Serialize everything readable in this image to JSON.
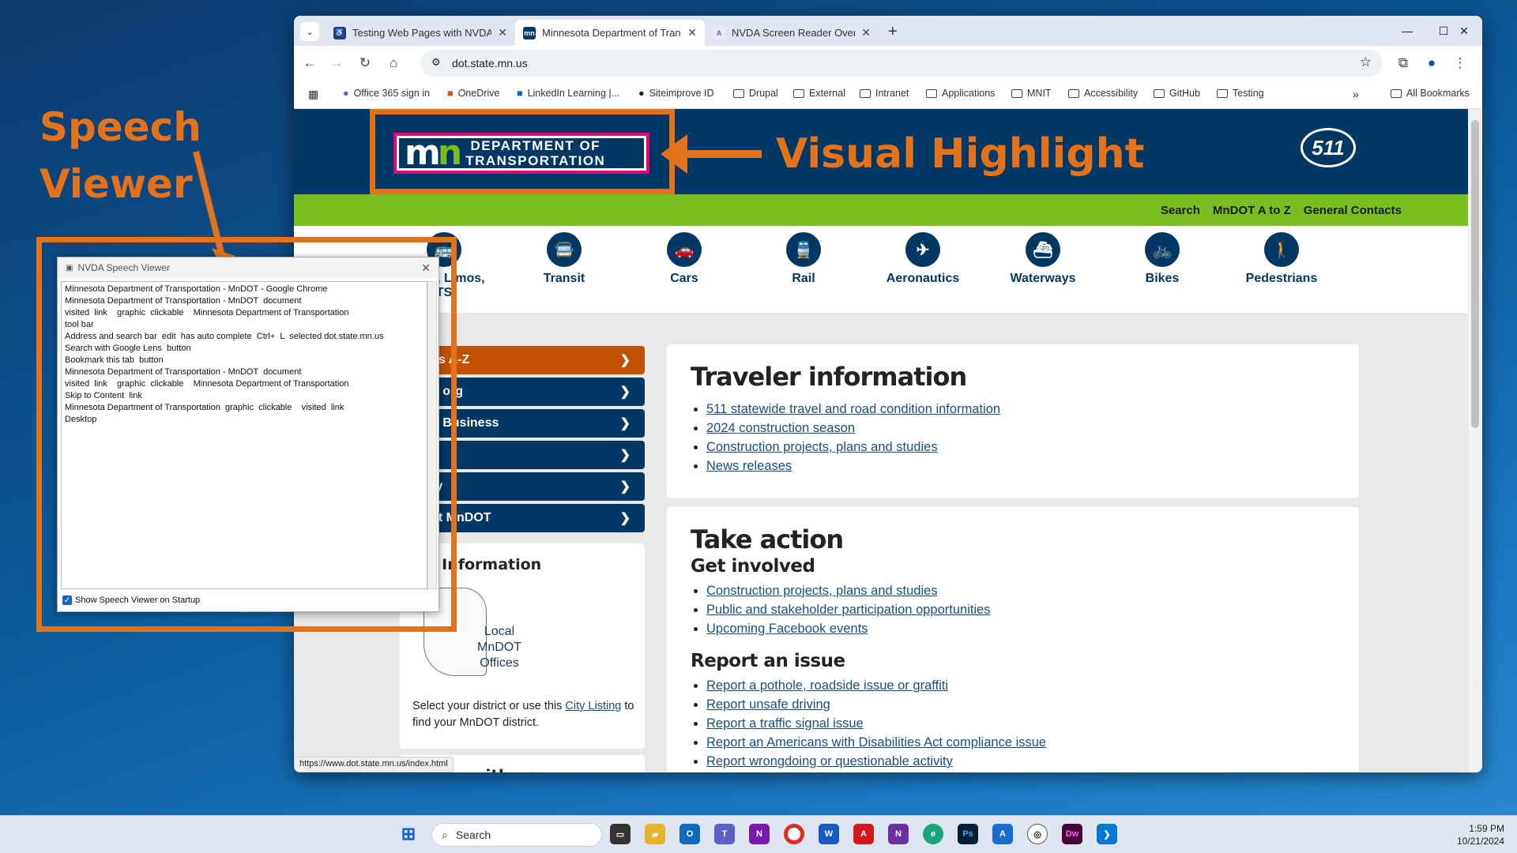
{
  "browser": {
    "tabs": [
      {
        "title": "Testing Web Pages with NVDA",
        "favicon": "accessibility-icon",
        "color": "#2b3a67"
      },
      {
        "title": "Minnesota Department of Trans",
        "favicon": "mn-icon",
        "color": "#003865"
      },
      {
        "title": "NVDA Screen Reader Overview",
        "favicon": "a-icon",
        "color": "#7a5cc2"
      }
    ],
    "url": "dot.state.mn.us",
    "bookmarks": [
      "Office 365 sign in",
      "OneDrive",
      "LinkedIn Learning |...",
      "Siteimprove ID",
      "Drupal",
      "External",
      "Intranet",
      "Applications",
      "MNIT",
      "Accessibility",
      "GitHub",
      "Testing"
    ],
    "all_bookmarks": "All Bookmarks",
    "status_url": "https://www.dot.state.mn.us/index.html"
  },
  "site": {
    "logo_line1": "DEPARTMENT OF",
    "logo_line2": "TRANSPORTATION",
    "badge": "511",
    "top_links": [
      "Search",
      "MnDOT A to Z",
      "General Contacts"
    ],
    "modes": [
      {
        "label": "B  ses, Limos,",
        "label2": "TS",
        "icon": "bus-icon",
        "glyph": "🚌"
      },
      {
        "label": "Transit",
        "icon": "transit-icon",
        "glyph": "🚍"
      },
      {
        "label": "Cars",
        "icon": "car-icon",
        "glyph": "🚗"
      },
      {
        "label": "Rail",
        "icon": "rail-icon",
        "glyph": "🚆"
      },
      {
        "label": "Aeronautics",
        "icon": "plane-icon",
        "glyph": "✈"
      },
      {
        "label": "Waterways",
        "icon": "ship-icon",
        "glyph": "⛴"
      },
      {
        "label": "Bikes",
        "icon": "bike-icon",
        "glyph": "🚲"
      },
      {
        "label": "Pedestrians",
        "icon": "pedestrian-icon",
        "glyph": "🚶"
      }
    ],
    "nav": [
      "cs A-Z",
      "n  org",
      "g Business",
      "",
      "ty",
      "at MnDOT"
    ],
    "districts_title": "l Information",
    "map_label": "Local\nMnDOT\nOffices",
    "districts_text": "Select your district or use this",
    "districts_link": "City Listing",
    "districts_text2": "to find your MnDOT district.",
    "withus": "with us",
    "traveler": {
      "title": "Traveler information",
      "links": [
        "511 statewide travel and road condition information",
        "2024 construction season",
        "Construction projects, plans and studies",
        "News releases"
      ]
    },
    "action": {
      "title": "Take action",
      "sub1": "Get involved",
      "links1": [
        "Construction projects, plans and studies",
        "Public and stakeholder participation opportunities",
        "Upcoming Facebook events"
      ],
      "sub2": "Report an issue",
      "links2": [
        "Report a pothole, roadside issue or graffiti",
        "Report unsafe driving",
        "Report a traffic signal issue",
        "Report an Americans with Disabilities Act compliance issue",
        "Report wrongdoing or questionable activity"
      ]
    }
  },
  "speech_viewer": {
    "title": "NVDA Speech Viewer",
    "lines": [
      "Minnesota Department of Transportation - MnDOT - Google Chrome",
      "Minnesota Department of Transportation - MnDOT  document",
      "visited  link    graphic  clickable    Minnesota Department of Transportation",
      "tool bar",
      "Address and search bar  edit  has auto complete  Ctrl+  L  selected dot.state.mn.us",
      "Search with Google Lens  button",
      "Bookmark this tab  button",
      "Minnesota Department of Transportation - MnDOT  document",
      "visited  link    graphic  clickable    Minnesota Department of Transportation",
      "Skip to Content  link",
      "Minnesota Department of Transportation  graphic  clickable    visited  link",
      "Desktop"
    ],
    "checkbox_label": "Show Speech Viewer on Startup"
  },
  "annotations": {
    "speech_viewer": "Speech\nViewer",
    "visual_highlight": "Visual Highlight",
    "color": "#e3721a"
  },
  "taskbar": {
    "search": "Search",
    "time": "1:59 PM",
    "date": "10/21/2024"
  }
}
